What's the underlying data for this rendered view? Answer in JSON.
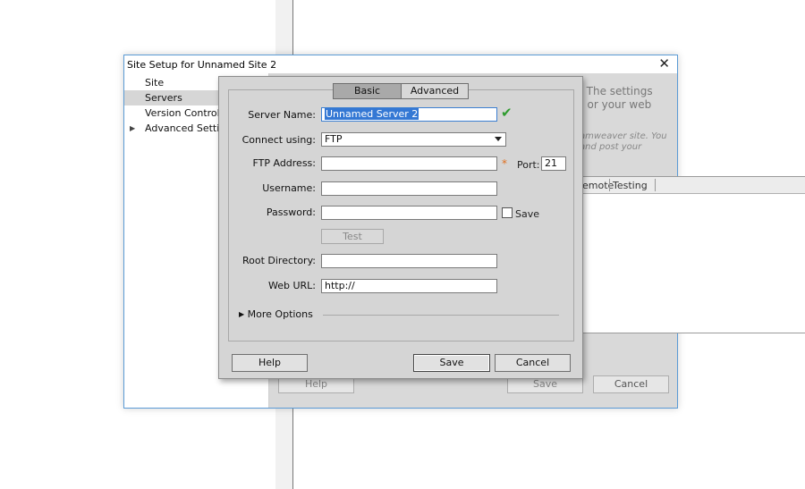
{
  "outer": {
    "title": "Site Setup for Unnamed Site 2",
    "close": "✕",
    "left_items": [
      {
        "label": "Site",
        "selected": false
      },
      {
        "label": "Servers",
        "selected": true
      },
      {
        "label": "Version Control",
        "selected": false
      },
      {
        "label": "Advanced Settings",
        "selected": false,
        "expander": "▶"
      }
    ],
    "right_text_lines": [
      ". The settings",
      ") or your web"
    ],
    "right_italic_lines": [
      "amweaver site. You",
      "and post your"
    ],
    "table_headers": [
      "emote",
      "Testing"
    ],
    "buttons": {
      "help": "Help",
      "save": "Save",
      "cancel": "Cancel"
    }
  },
  "dialog": {
    "tabs": {
      "basic": "Basic",
      "advanced": "Advanced",
      "active": "Basic"
    },
    "server_name": {
      "label": "Server Name:",
      "value": "Unnamed Server 2"
    },
    "connect_using": {
      "label": "Connect using:",
      "value": "FTP"
    },
    "ftp_address": {
      "label": "FTP Address:",
      "value": "",
      "required_marker": "*"
    },
    "port": {
      "label": "Port:",
      "value": "21"
    },
    "username": {
      "label": "Username:",
      "value": ""
    },
    "password": {
      "label": "Password:",
      "value": "",
      "save_label": "Save",
      "save_checked": false
    },
    "test_button": "Test",
    "root_directory": {
      "label": "Root Directory:",
      "value": ""
    },
    "web_url": {
      "label": "Web URL:",
      "value": "http://"
    },
    "more_options": {
      "arrow": "▶",
      "label": "More Options"
    },
    "buttons": {
      "help": "Help",
      "save": "Save",
      "cancel": "Cancel"
    },
    "valid_icon": "✔"
  },
  "colors": {
    "accent_border": "#5b9bd5",
    "selection": "#3478d4",
    "valid_check": "#2e9b2e",
    "required_star": "#e07020"
  }
}
